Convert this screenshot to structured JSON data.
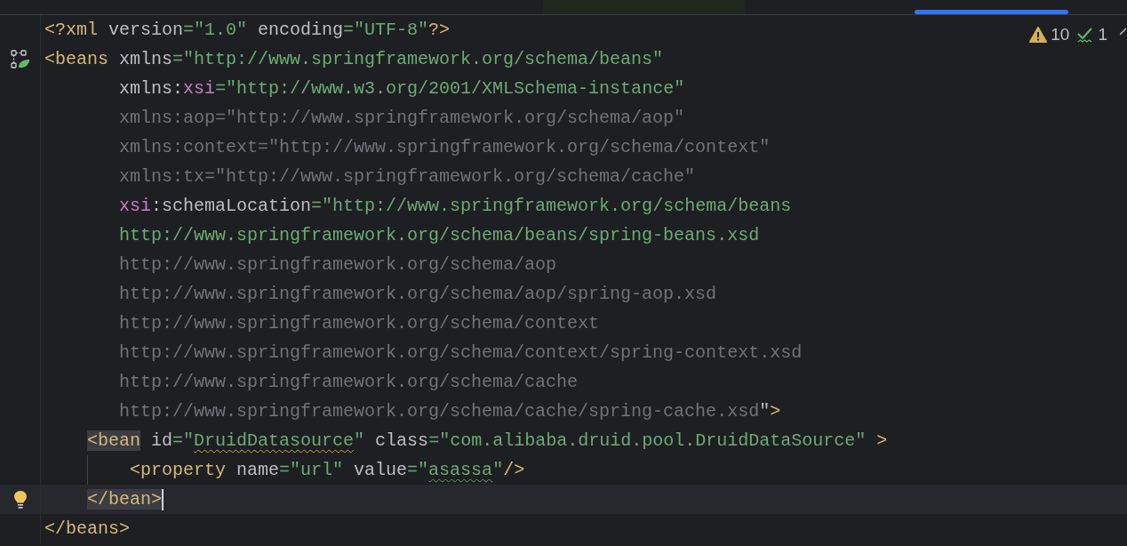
{
  "inspections": [
    {
      "kind": "warning",
      "count": "10"
    },
    {
      "kind": "typo",
      "count": "1"
    }
  ],
  "lines": [
    {
      "current": false,
      "tokens": [
        {
          "kind": "tag",
          "text": "<?xml"
        },
        {
          "kind": "attr",
          "text": " version"
        },
        {
          "kind": "str",
          "text": "=\"1.0\""
        },
        {
          "kind": "attr",
          "text": " encoding"
        },
        {
          "kind": "str",
          "text": "=\"UTF-8\""
        },
        {
          "kind": "tag",
          "text": "?>"
        }
      ]
    },
    {
      "current": false,
      "gutter_icon": {
        "kind": "bean"
      },
      "tokens": [
        {
          "kind": "tag",
          "text": "<beans"
        },
        {
          "kind": "attr",
          "text": " xmlns"
        },
        {
          "kind": "str",
          "text": "=\"http://www.springframework.org/schema/beans\""
        }
      ]
    },
    {
      "current": false,
      "tokens": [
        {
          "kind": "attr",
          "text": "       xmlns:"
        },
        {
          "kind": "ns",
          "text": "xsi"
        },
        {
          "kind": "str",
          "text": "=\"http://www.w3.org/2001/XMLSchema-instance\""
        }
      ]
    },
    {
      "current": false,
      "tokens": [
        {
          "kind": "dim",
          "text": "       xmlns:aop=\"http://www.springframework.org/schema/aop\""
        }
      ]
    },
    {
      "current": false,
      "tokens": [
        {
          "kind": "dim",
          "text": "       xmlns:context=\"http://www.springframework.org/schema/context\""
        }
      ]
    },
    {
      "current": false,
      "tokens": [
        {
          "kind": "dim",
          "text": "       xmlns:tx=\"http://www.springframework.org/schema/cache\""
        }
      ]
    },
    {
      "current": false,
      "tokens": [
        {
          "kind": "ns",
          "text": "       xsi"
        },
        {
          "kind": "attr",
          "text": ":schemaLocation"
        },
        {
          "kind": "str",
          "text": "=\"http://www.springframework.org/schema/beans"
        }
      ]
    },
    {
      "current": false,
      "tokens": [
        {
          "kind": "str",
          "text": "       http://www.springframework.org/schema/beans/spring-beans.xsd"
        }
      ]
    },
    {
      "current": false,
      "tokens": [
        {
          "kind": "dim",
          "text": "       http://www.springframework.org/schema/aop"
        }
      ]
    },
    {
      "current": false,
      "tokens": [
        {
          "kind": "dim",
          "text": "       http://www.springframework.org/schema/aop/spring-aop.xsd"
        }
      ]
    },
    {
      "current": false,
      "tokens": [
        {
          "kind": "dim",
          "text": "       http://www.springframework.org/schema/context"
        }
      ]
    },
    {
      "current": false,
      "tokens": [
        {
          "kind": "dim",
          "text": "       http://www.springframework.org/schema/context/spring-context.xsd"
        }
      ]
    },
    {
      "current": false,
      "tokens": [
        {
          "kind": "dim",
          "text": "       http://www.springframework.org/schema/cache"
        }
      ]
    },
    {
      "current": false,
      "tokens": [
        {
          "kind": "dim",
          "text": "       http://www.springframework.org/schema/cache/spring-cache.xsd"
        },
        {
          "kind": "attr",
          "text": "\""
        },
        {
          "kind": "tag",
          "text": ">"
        }
      ]
    },
    {
      "current": false,
      "tokens": [
        {
          "kind": "tag",
          "text": "    <bean",
          "matched": true
        },
        {
          "kind": "attr",
          "text": " id"
        },
        {
          "kind": "str",
          "text": "=\""
        },
        {
          "kind": "str",
          "text": "DruidDatasource",
          "warning": true
        },
        {
          "kind": "str",
          "text": "\""
        },
        {
          "kind": "attr",
          "text": " class"
        },
        {
          "kind": "str",
          "text": "=\"com.alibaba.druid.pool.DruidDataSource\""
        },
        {
          "kind": "tag",
          "text": " >"
        }
      ]
    },
    {
      "current": false,
      "guide": true,
      "tokens": [
        {
          "kind": "tag",
          "text": "        <property"
        },
        {
          "kind": "attr",
          "text": " name"
        },
        {
          "kind": "str",
          "text": "=\"url\""
        },
        {
          "kind": "attr",
          "text": " value"
        },
        {
          "kind": "str",
          "text": "=\""
        },
        {
          "kind": "str",
          "text": "asassa",
          "typo": true
        },
        {
          "kind": "str",
          "text": "\""
        },
        {
          "kind": "tag",
          "text": "/>"
        }
      ]
    },
    {
      "current": true,
      "gutter_icon": {
        "kind": "bulb"
      },
      "tokens": [
        {
          "kind": "tag",
          "text": "    </bean>",
          "matched": true
        }
      ]
    },
    {
      "current": false,
      "tokens": [
        {
          "kind": "tag",
          "text": "</beans>"
        }
      ]
    }
  ]
}
